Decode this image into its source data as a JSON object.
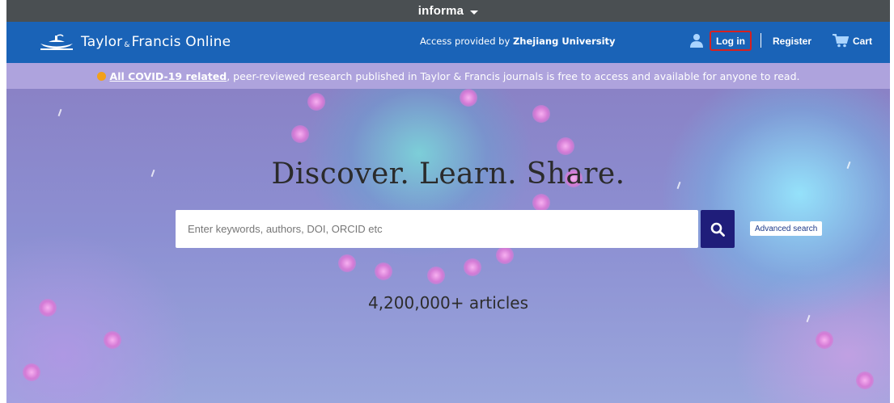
{
  "informa_bar": {
    "brand": "informa"
  },
  "header": {
    "logo_main": "Taylor",
    "logo_amp": "&",
    "logo_rest": "Francis Online",
    "access_prefix": "Access provided by ",
    "institution": "Zhejiang University",
    "login_label": "Log in",
    "register_label": "Register",
    "cart_label": "Cart"
  },
  "banner": {
    "link_text": "All COVID-19 related",
    "message": ", peer-reviewed research published in Taylor & Francis journals is free to access and available for anyone to read.",
    "dot_color": "#f2a019"
  },
  "hero": {
    "headline": "Discover. Learn. Share.",
    "search_placeholder": "Enter keywords, authors, DOI, ORCID etc",
    "search_value": "",
    "advanced_label": "Advanced search",
    "article_count": "4,200,000+ articles"
  },
  "colors": {
    "informa_bar": "#4a4f52",
    "nav": "#1a63b7",
    "banner": "#aea3dd",
    "search_button": "#1f1d7a",
    "login_highlight": "#d8201f"
  },
  "icons": [
    "chevron-down-icon",
    "lamp-logo-icon",
    "user-icon",
    "cart-icon",
    "search-icon",
    "info-icon"
  ]
}
